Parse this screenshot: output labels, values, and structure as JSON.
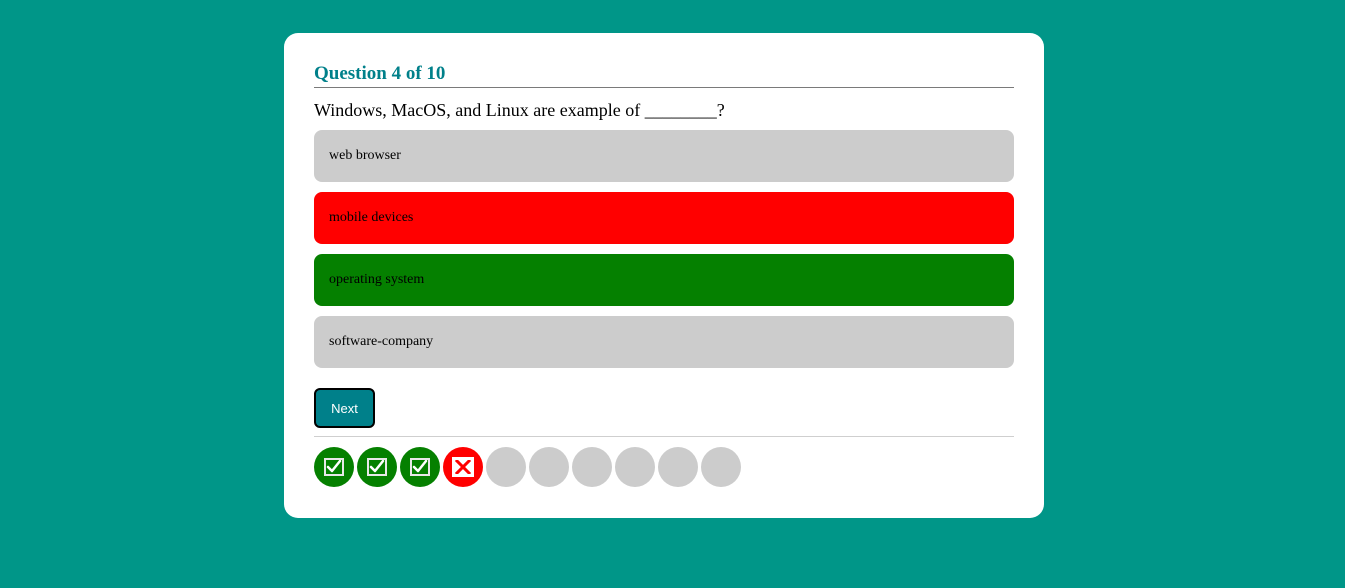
{
  "quiz": {
    "title": "Question 4 of 10",
    "question": "Windows, MacOS, and Linux are example of ________?",
    "options": [
      {
        "label": "web browser",
        "state": "neutral",
        "color": "#cccccc"
      },
      {
        "label": "mobile devices",
        "state": "incorrect",
        "color": "#ff0000"
      },
      {
        "label": "operating system",
        "state": "correct",
        "color": "#058000"
      },
      {
        "label": "software-company",
        "state": "neutral",
        "color": "#cccccc"
      }
    ],
    "next_label": "Next"
  },
  "progress": {
    "total": 10,
    "answered": 4,
    "results": [
      "correct",
      "correct",
      "correct",
      "incorrect",
      "pending",
      "pending",
      "pending",
      "pending",
      "pending",
      "pending"
    ],
    "icons": {
      "correct": "check-icon",
      "incorrect": "cross-icon"
    },
    "colors": {
      "correct": "#058000",
      "incorrect": "#ff0000",
      "pending": "#cccccc"
    }
  },
  "theme": {
    "background": "#009688",
    "accent": "#00808a",
    "card": "#ffffff"
  }
}
